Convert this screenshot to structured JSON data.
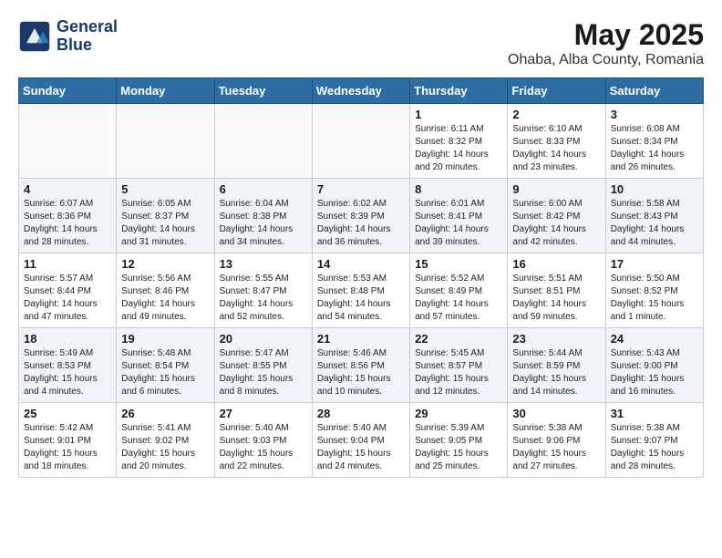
{
  "header": {
    "logo_line1": "General",
    "logo_line2": "Blue",
    "month_year": "May 2025",
    "location": "Ohaba, Alba County, Romania"
  },
  "days_of_week": [
    "Sunday",
    "Monday",
    "Tuesday",
    "Wednesday",
    "Thursday",
    "Friday",
    "Saturday"
  ],
  "weeks": [
    [
      {
        "day": "",
        "info": ""
      },
      {
        "day": "",
        "info": ""
      },
      {
        "day": "",
        "info": ""
      },
      {
        "day": "",
        "info": ""
      },
      {
        "day": "1",
        "info": "Sunrise: 6:11 AM\nSunset: 8:32 PM\nDaylight: 14 hours\nand 20 minutes."
      },
      {
        "day": "2",
        "info": "Sunrise: 6:10 AM\nSunset: 8:33 PM\nDaylight: 14 hours\nand 23 minutes."
      },
      {
        "day": "3",
        "info": "Sunrise: 6:08 AM\nSunset: 8:34 PM\nDaylight: 14 hours\nand 26 minutes."
      }
    ],
    [
      {
        "day": "4",
        "info": "Sunrise: 6:07 AM\nSunset: 8:36 PM\nDaylight: 14 hours\nand 28 minutes."
      },
      {
        "day": "5",
        "info": "Sunrise: 6:05 AM\nSunset: 8:37 PM\nDaylight: 14 hours\nand 31 minutes."
      },
      {
        "day": "6",
        "info": "Sunrise: 6:04 AM\nSunset: 8:38 PM\nDaylight: 14 hours\nand 34 minutes."
      },
      {
        "day": "7",
        "info": "Sunrise: 6:02 AM\nSunset: 8:39 PM\nDaylight: 14 hours\nand 36 minutes."
      },
      {
        "day": "8",
        "info": "Sunrise: 6:01 AM\nSunset: 8:41 PM\nDaylight: 14 hours\nand 39 minutes."
      },
      {
        "day": "9",
        "info": "Sunrise: 6:00 AM\nSunset: 8:42 PM\nDaylight: 14 hours\nand 42 minutes."
      },
      {
        "day": "10",
        "info": "Sunrise: 5:58 AM\nSunset: 8:43 PM\nDaylight: 14 hours\nand 44 minutes."
      }
    ],
    [
      {
        "day": "11",
        "info": "Sunrise: 5:57 AM\nSunset: 8:44 PM\nDaylight: 14 hours\nand 47 minutes."
      },
      {
        "day": "12",
        "info": "Sunrise: 5:56 AM\nSunset: 8:46 PM\nDaylight: 14 hours\nand 49 minutes."
      },
      {
        "day": "13",
        "info": "Sunrise: 5:55 AM\nSunset: 8:47 PM\nDaylight: 14 hours\nand 52 minutes."
      },
      {
        "day": "14",
        "info": "Sunrise: 5:53 AM\nSunset: 8:48 PM\nDaylight: 14 hours\nand 54 minutes."
      },
      {
        "day": "15",
        "info": "Sunrise: 5:52 AM\nSunset: 8:49 PM\nDaylight: 14 hours\nand 57 minutes."
      },
      {
        "day": "16",
        "info": "Sunrise: 5:51 AM\nSunset: 8:51 PM\nDaylight: 14 hours\nand 59 minutes."
      },
      {
        "day": "17",
        "info": "Sunrise: 5:50 AM\nSunset: 8:52 PM\nDaylight: 15 hours\nand 1 minute."
      }
    ],
    [
      {
        "day": "18",
        "info": "Sunrise: 5:49 AM\nSunset: 8:53 PM\nDaylight: 15 hours\nand 4 minutes."
      },
      {
        "day": "19",
        "info": "Sunrise: 5:48 AM\nSunset: 8:54 PM\nDaylight: 15 hours\nand 6 minutes."
      },
      {
        "day": "20",
        "info": "Sunrise: 5:47 AM\nSunset: 8:55 PM\nDaylight: 15 hours\nand 8 minutes."
      },
      {
        "day": "21",
        "info": "Sunrise: 5:46 AM\nSunset: 8:56 PM\nDaylight: 15 hours\nand 10 minutes."
      },
      {
        "day": "22",
        "info": "Sunrise: 5:45 AM\nSunset: 8:57 PM\nDaylight: 15 hours\nand 12 minutes."
      },
      {
        "day": "23",
        "info": "Sunrise: 5:44 AM\nSunset: 8:59 PM\nDaylight: 15 hours\nand 14 minutes."
      },
      {
        "day": "24",
        "info": "Sunrise: 5:43 AM\nSunset: 9:00 PM\nDaylight: 15 hours\nand 16 minutes."
      }
    ],
    [
      {
        "day": "25",
        "info": "Sunrise: 5:42 AM\nSunset: 9:01 PM\nDaylight: 15 hours\nand 18 minutes."
      },
      {
        "day": "26",
        "info": "Sunrise: 5:41 AM\nSunset: 9:02 PM\nDaylight: 15 hours\nand 20 minutes."
      },
      {
        "day": "27",
        "info": "Sunrise: 5:40 AM\nSunset: 9:03 PM\nDaylight: 15 hours\nand 22 minutes."
      },
      {
        "day": "28",
        "info": "Sunrise: 5:40 AM\nSunset: 9:04 PM\nDaylight: 15 hours\nand 24 minutes."
      },
      {
        "day": "29",
        "info": "Sunrise: 5:39 AM\nSunset: 9:05 PM\nDaylight: 15 hours\nand 25 minutes."
      },
      {
        "day": "30",
        "info": "Sunrise: 5:38 AM\nSunset: 9:06 PM\nDaylight: 15 hours\nand 27 minutes."
      },
      {
        "day": "31",
        "info": "Sunrise: 5:38 AM\nSunset: 9:07 PM\nDaylight: 15 hours\nand 28 minutes."
      }
    ]
  ]
}
